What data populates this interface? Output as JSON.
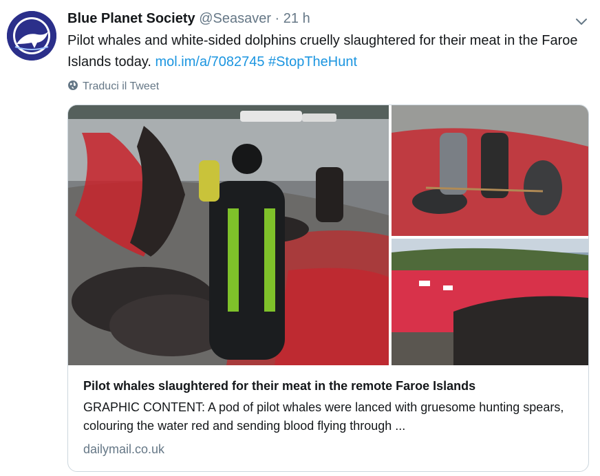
{
  "tweet": {
    "author_name": "Blue Planet Society",
    "handle": "@Seasaver",
    "separator": "·",
    "time": "21 h",
    "text_plain": "Pilot whales and white-sided dolphins cruelly slaughtered for their meat in the Faroe Islands today.",
    "link": "mol.im/a/7082745",
    "hashtag": "#StopTheHunt",
    "translate_label": "Traduci il Tweet",
    "avatar_text": "BLUE PLANET SOCIETY"
  },
  "card": {
    "title": "Pilot whales slaughtered for their meat in the remote Faroe Islands",
    "description": "GRAPHIC CONTENT: A pod of pilot whales were lanced with gruesome hunting spears, colouring the water red and sending blood flying through ...",
    "domain": "dailymail.co.uk"
  },
  "colors": {
    "link": "#1b95e0",
    "secondary_text": "#657786",
    "border": "#ccd6dd",
    "avatar_bg": "#2b2f8a",
    "blood_red": "#c8232c"
  },
  "icons": [
    "globe-icon",
    "chevron-down-icon"
  ]
}
